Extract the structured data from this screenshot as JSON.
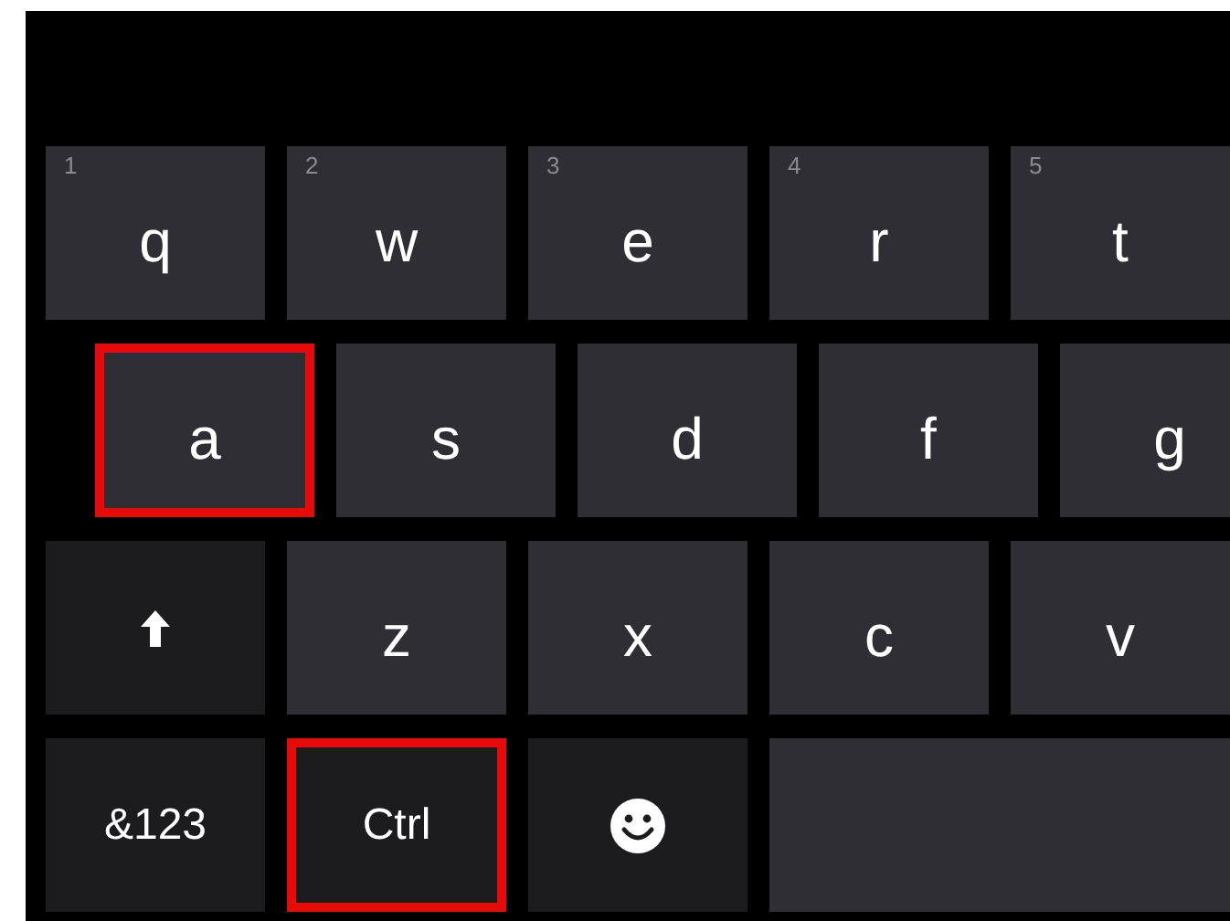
{
  "rows": [
    {
      "keys": [
        {
          "kind": "letter",
          "label": "q",
          "hint": "1",
          "highlighted": false
        },
        {
          "kind": "letter",
          "label": "w",
          "hint": "2",
          "highlighted": false
        },
        {
          "kind": "letter",
          "label": "e",
          "hint": "3",
          "highlighted": false
        },
        {
          "kind": "letter",
          "label": "r",
          "hint": "4",
          "highlighted": false
        },
        {
          "kind": "letter",
          "label": "t",
          "hint": "5",
          "highlighted": false
        }
      ]
    },
    {
      "keys": [
        {
          "kind": "letter",
          "label": "a",
          "highlighted": true
        },
        {
          "kind": "letter",
          "label": "s",
          "highlighted": false
        },
        {
          "kind": "letter",
          "label": "d",
          "highlighted": false
        },
        {
          "kind": "letter",
          "label": "f",
          "highlighted": false
        },
        {
          "kind": "letter",
          "label": "g",
          "highlighted": false
        }
      ]
    },
    {
      "keys": [
        {
          "kind": "shift",
          "highlighted": false
        },
        {
          "kind": "letter",
          "label": "z",
          "highlighted": false
        },
        {
          "kind": "letter",
          "label": "x",
          "highlighted": false
        },
        {
          "kind": "letter",
          "label": "c",
          "highlighted": false
        },
        {
          "kind": "letter",
          "label": "v",
          "highlighted": false
        }
      ]
    },
    {
      "keys": [
        {
          "kind": "function",
          "label": "&123",
          "highlighted": false
        },
        {
          "kind": "function",
          "label": "Ctrl",
          "highlighted": true
        },
        {
          "kind": "emoji",
          "highlighted": false
        },
        {
          "kind": "space",
          "highlighted": false
        }
      ]
    }
  ]
}
